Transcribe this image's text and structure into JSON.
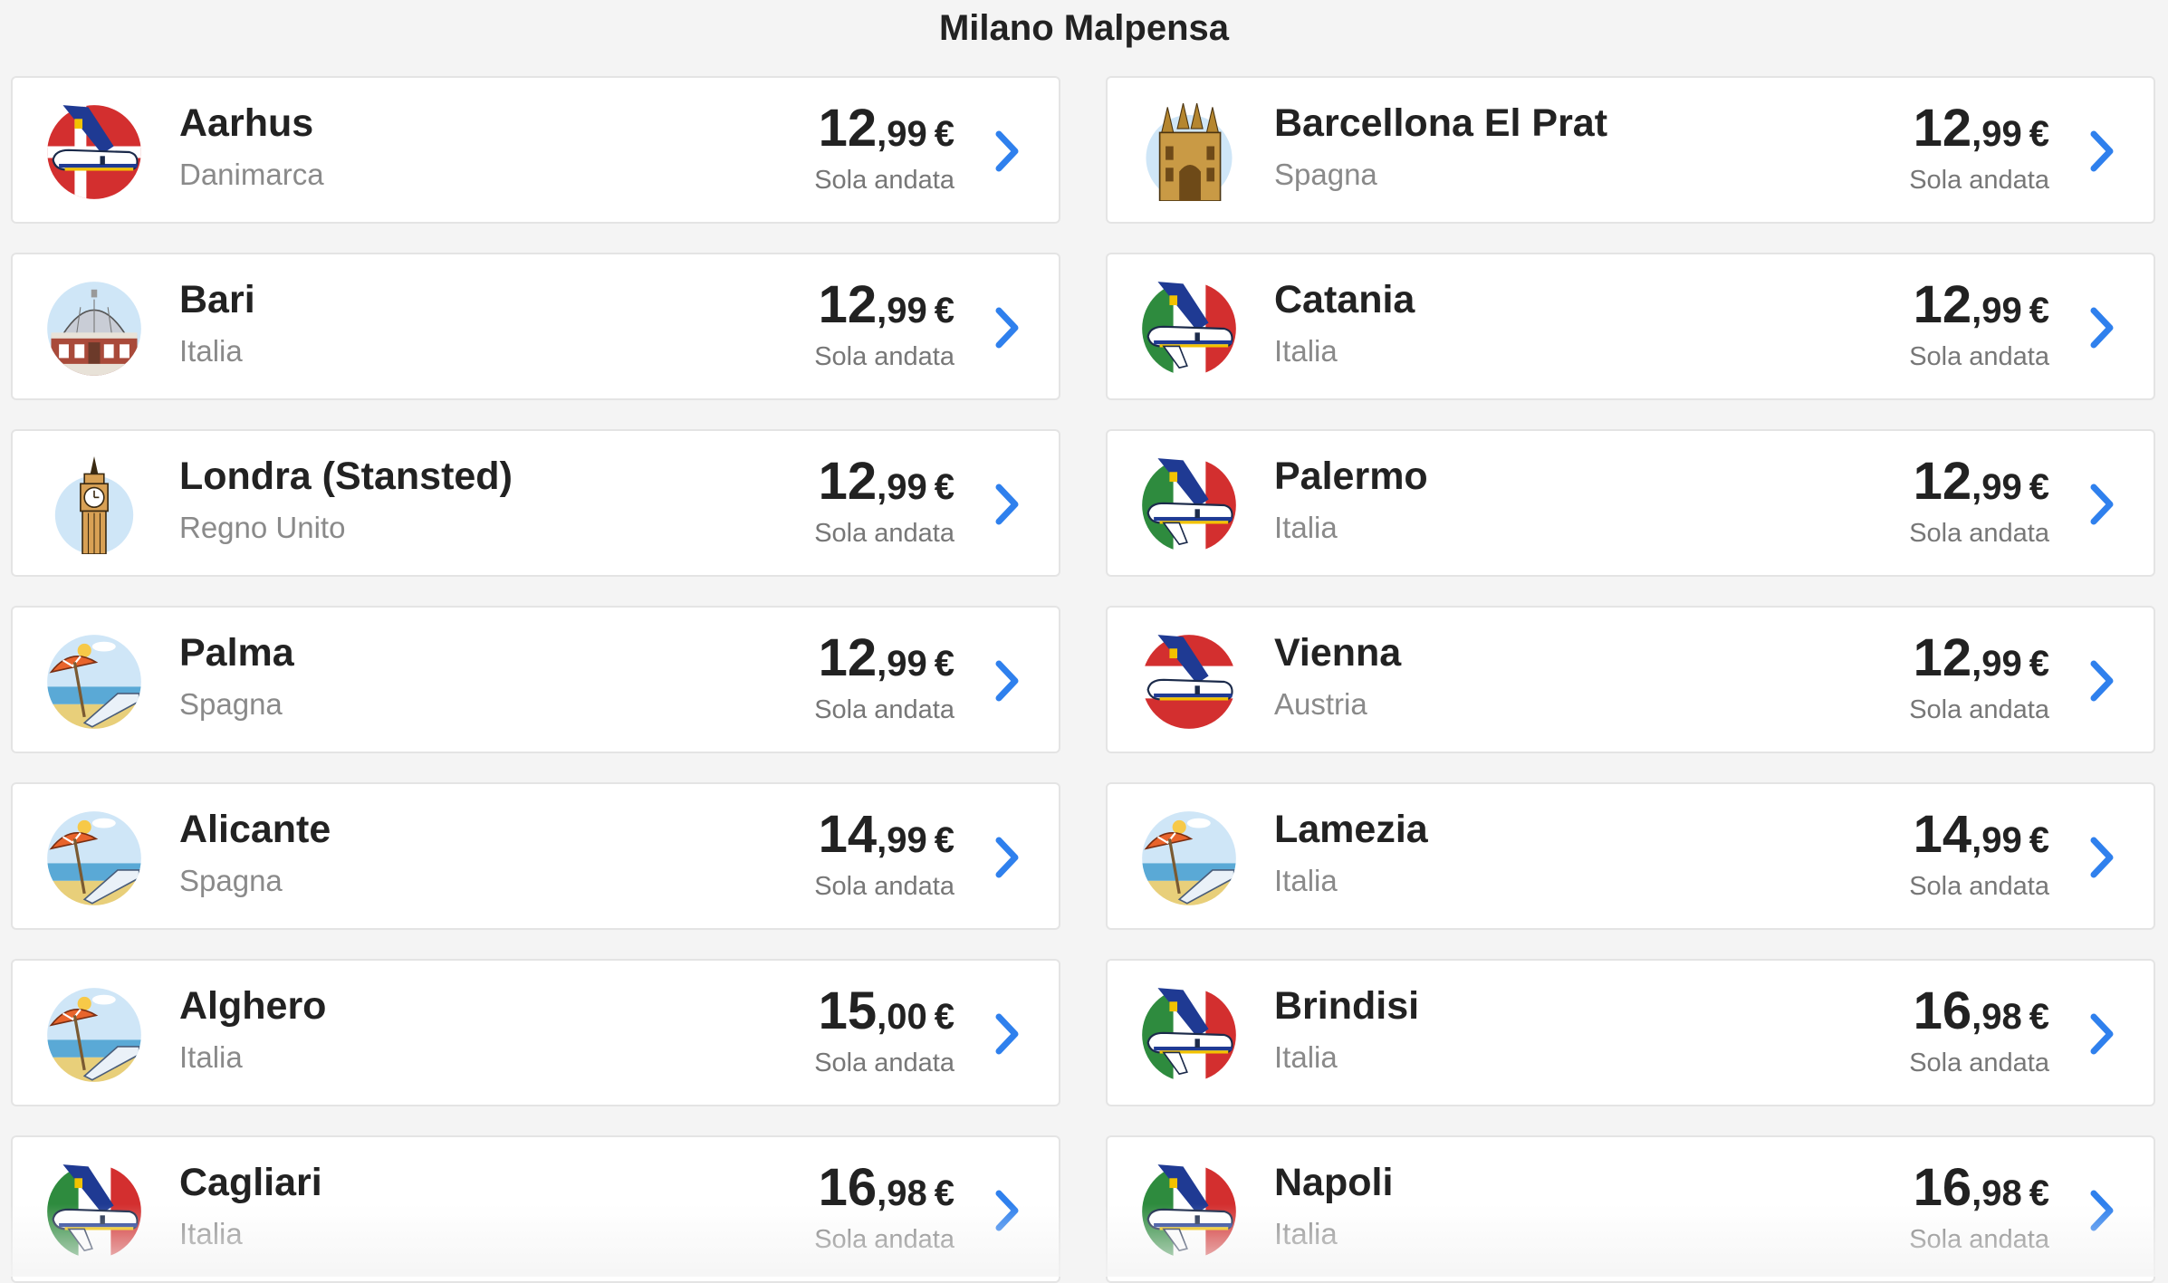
{
  "page": {
    "title": "Milano Malpensa"
  },
  "colors": {
    "chevron": "#2f80ed",
    "country": "#8a8a8a"
  },
  "routes": [
    {
      "city": "Aarhus",
      "country": "Danimarca",
      "price_int": "12",
      "price_dec": ",99",
      "currency": "€",
      "fare": "Sola andata",
      "icon": "plane-denmark-icon"
    },
    {
      "city": "Barcellona El Prat",
      "country": "Spagna",
      "price_int": "12",
      "price_dec": ",99",
      "currency": "€",
      "fare": "Sola andata",
      "icon": "sagrada-familia-icon"
    },
    {
      "city": "Bari",
      "country": "Italia",
      "price_int": "12",
      "price_dec": ",99",
      "currency": "€",
      "fare": "Sola andata",
      "icon": "dome-building-icon"
    },
    {
      "city": "Catania",
      "country": "Italia",
      "price_int": "12",
      "price_dec": ",99",
      "currency": "€",
      "fare": "Sola andata",
      "icon": "plane-italy-icon"
    },
    {
      "city": "Londra (Stansted)",
      "country": "Regno Unito",
      "price_int": "12",
      "price_dec": ",99",
      "currency": "€",
      "fare": "Sola andata",
      "icon": "big-ben-icon"
    },
    {
      "city": "Palermo",
      "country": "Italia",
      "price_int": "12",
      "price_dec": ",99",
      "currency": "€",
      "fare": "Sola andata",
      "icon": "plane-italy-icon"
    },
    {
      "city": "Palma",
      "country": "Spagna",
      "price_int": "12",
      "price_dec": ",99",
      "currency": "€",
      "fare": "Sola andata",
      "icon": "beach-umbrella-icon"
    },
    {
      "city": "Vienna",
      "country": "Austria",
      "price_int": "12",
      "price_dec": ",99",
      "currency": "€",
      "fare": "Sola andata",
      "icon": "plane-austria-icon"
    },
    {
      "city": "Alicante",
      "country": "Spagna",
      "price_int": "14",
      "price_dec": ",99",
      "currency": "€",
      "fare": "Sola andata",
      "icon": "beach-umbrella-icon"
    },
    {
      "city": "Lamezia",
      "country": "Italia",
      "price_int": "14",
      "price_dec": ",99",
      "currency": "€",
      "fare": "Sola andata",
      "icon": "beach-umbrella-icon"
    },
    {
      "city": "Alghero",
      "country": "Italia",
      "price_int": "15",
      "price_dec": ",00",
      "currency": "€",
      "fare": "Sola andata",
      "icon": "beach-umbrella-icon"
    },
    {
      "city": "Brindisi",
      "country": "Italia",
      "price_int": "16",
      "price_dec": ",98",
      "currency": "€",
      "fare": "Sola andata",
      "icon": "plane-italy-icon"
    },
    {
      "city": "Cagliari",
      "country": "Italia",
      "price_int": "16",
      "price_dec": ",98",
      "currency": "€",
      "fare": "Sola andata",
      "icon": "plane-italy-icon"
    },
    {
      "city": "Napoli",
      "country": "Italia",
      "price_int": "16",
      "price_dec": ",98",
      "currency": "€",
      "fare": "Sola andata",
      "icon": "plane-italy-icon"
    }
  ]
}
